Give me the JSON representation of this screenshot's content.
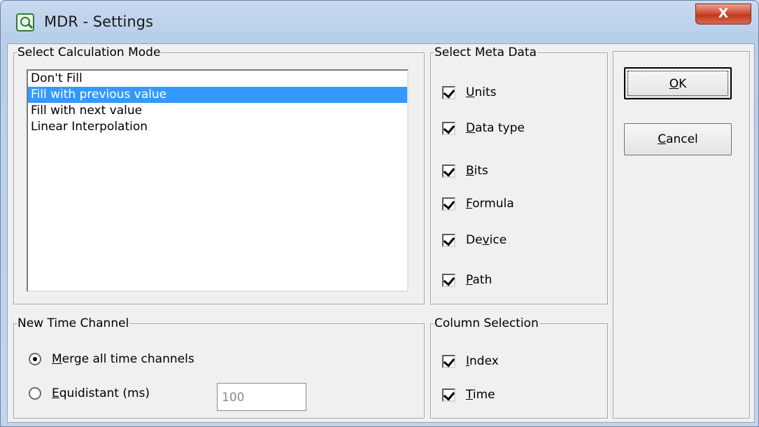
{
  "window": {
    "title": "MDR - Settings",
    "close_label": "X"
  },
  "calc_mode": {
    "legend": "Select Calculation Mode",
    "items": [
      {
        "label": "Don't Fill",
        "selected": false
      },
      {
        "label": "Fill with previous value",
        "selected": true
      },
      {
        "label": "Fill with next value",
        "selected": false
      },
      {
        "label": "Linear Interpolation",
        "selected": false
      }
    ]
  },
  "meta_data": {
    "legend": "Select Meta Data",
    "items": [
      {
        "pre": "",
        "accel": "U",
        "post": "nits",
        "checked": true
      },
      {
        "pre": "",
        "accel": "D",
        "post": "ata type",
        "checked": true
      },
      {
        "pre": "",
        "accel": "B",
        "post": "its",
        "checked": true
      },
      {
        "pre": "",
        "accel": "F",
        "post": "ormula",
        "checked": true
      },
      {
        "pre": "De",
        "accel": "v",
        "post": "ice",
        "checked": true
      },
      {
        "pre": "",
        "accel": "P",
        "post": "ath",
        "checked": true
      }
    ]
  },
  "time_channel": {
    "legend": "New Time Channel",
    "merge": {
      "pre": "",
      "accel": "M",
      "post": "erge all time channels",
      "selected": true
    },
    "equidistant": {
      "pre": "",
      "accel": "E",
      "post": "quidistant (ms)",
      "selected": false
    },
    "interval_value": "100"
  },
  "column_selection": {
    "legend": "Column Selection",
    "index": {
      "pre": "",
      "accel": "I",
      "post": "ndex",
      "checked": true
    },
    "time": {
      "pre": "",
      "accel": "T",
      "post": "ime",
      "checked": true
    }
  },
  "buttons": {
    "ok": {
      "pre": "",
      "accel": "O",
      "post": "K"
    },
    "cancel": {
      "pre": "",
      "accel": "C",
      "post": "ancel"
    }
  },
  "colors": {
    "selection": "#3399ff",
    "close_button": "#c0371f"
  }
}
